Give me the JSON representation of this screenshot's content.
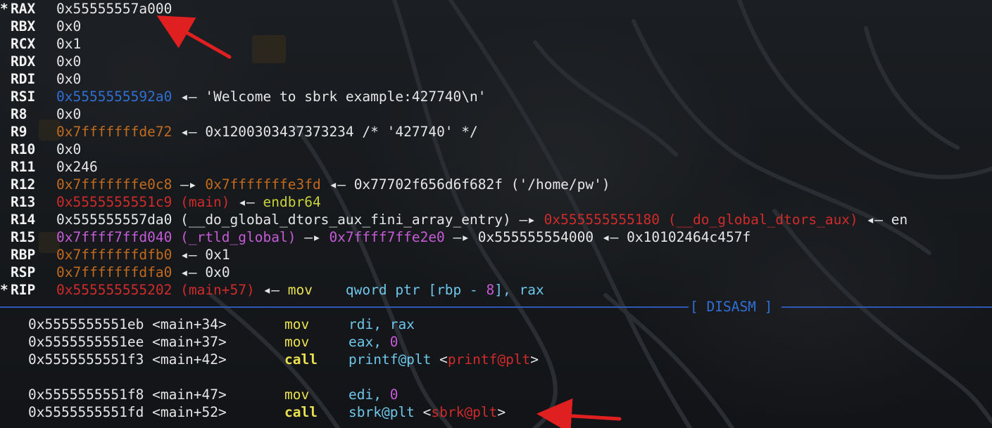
{
  "registers": [
    {
      "star": "*",
      "name": "RAX",
      "value": "0x55555557a000",
      "value_color": "w",
      "rest": []
    },
    {
      "star": "",
      "name": "RBX",
      "value": "0x0",
      "value_color": "w",
      "rest": []
    },
    {
      "star": "",
      "name": "RCX",
      "value": "0x1",
      "value_color": "w",
      "rest": []
    },
    {
      "star": "",
      "name": "RDX",
      "value": "0x0",
      "value_color": "w",
      "rest": []
    },
    {
      "star": "",
      "name": "RDI",
      "value": "0x0",
      "value_color": "w",
      "rest": []
    },
    {
      "star": "",
      "name": "RSI",
      "value": "0x5555555592a0",
      "value_color": "blue",
      "rest": [
        {
          "t": " ◂— ",
          "c": "w"
        },
        {
          "t": "'Welcome to sbrk example:427740\\n'",
          "c": "w"
        }
      ]
    },
    {
      "star": "",
      "name": "R8",
      "value": "0x0",
      "value_color": "w",
      "rest": []
    },
    {
      "star": "",
      "name": "R9",
      "value": "0x7fffffffde72",
      "value_color": "orange",
      "rest": [
        {
          "t": " ◂— ",
          "c": "w"
        },
        {
          "t": "0x1200303437373234 /* '427740' */",
          "c": "w"
        }
      ]
    },
    {
      "star": "",
      "name": "R10",
      "value": "0x0",
      "value_color": "w",
      "rest": []
    },
    {
      "star": "",
      "name": "R11",
      "value": "0x246",
      "value_color": "w",
      "rest": []
    },
    {
      "star": "",
      "name": "R12",
      "value": "0x7fffffffe0c8",
      "value_color": "orange",
      "rest": [
        {
          "t": " —▸ ",
          "c": "w"
        },
        {
          "t": "0x7fffffffe3fd",
          "c": "orange"
        },
        {
          "t": " ◂— ",
          "c": "w"
        },
        {
          "t": "0x77702f656d6f682f ('/home/pw')",
          "c": "w"
        }
      ]
    },
    {
      "star": "",
      "name": "R13",
      "value": "0x5555555551c9 (main)",
      "value_color": "red",
      "rest": [
        {
          "t": " ◂— ",
          "c": "w"
        },
        {
          "t": "endbr64",
          "c": "yellow"
        }
      ]
    },
    {
      "star": "",
      "name": "R14",
      "value": "0x555555557da0 (__do_global_dtors_aux_fini_array_entry)",
      "value_color": "w",
      "rest": [
        {
          "t": " —▸ ",
          "c": "w"
        },
        {
          "t": "0x555555555180 (__do_global_dtors_aux)",
          "c": "red"
        },
        {
          "t": " ◂— en",
          "c": "w"
        }
      ]
    },
    {
      "star": "",
      "name": "R15",
      "value": "0x7ffff7ffd040 (_rtld_global)",
      "value_color": "magenta",
      "rest": [
        {
          "t": " —▸ ",
          "c": "w"
        },
        {
          "t": "0x7ffff7ffe2e0",
          "c": "magenta"
        },
        {
          "t": " —▸ ",
          "c": "w"
        },
        {
          "t": "0x555555554000",
          "c": "w"
        },
        {
          "t": " ◂— ",
          "c": "w"
        },
        {
          "t": "0x10102464c457f",
          "c": "w"
        }
      ]
    },
    {
      "star": "",
      "name": "RBP",
      "value": "0x7fffffffdfb0",
      "value_color": "orange",
      "rest": [
        {
          "t": " ◂— ",
          "c": "w"
        },
        {
          "t": "0x1",
          "c": "w"
        }
      ]
    },
    {
      "star": "",
      "name": "RSP",
      "value": "0x7fffffffdfa0",
      "value_color": "orange",
      "rest": [
        {
          "t": " ◂— ",
          "c": "w"
        },
        {
          "t": "0x0",
          "c": "w"
        }
      ]
    },
    {
      "star": "*",
      "name": "RIP",
      "value": "0x555555555202 (main+57)",
      "value_color": "red",
      "rest": [
        {
          "t": " ◂— ",
          "c": "w"
        },
        {
          "t": "mov",
          "c": "kw"
        },
        {
          "t": "    qword ptr [rbp - ",
          "c": "cyan"
        },
        {
          "t": "8",
          "c": "magenta"
        },
        {
          "t": "], rax",
          "c": "cyan"
        }
      ]
    }
  ],
  "disasm_header": "[ DISASM ]",
  "disasm": [
    {
      "addr": "0x5555555551eb <main+34>",
      "op": "mov",
      "bold": false,
      "args": [
        {
          "t": "rdi, rax",
          "c": "cyan"
        }
      ]
    },
    {
      "addr": "0x5555555551ee <main+37>",
      "op": "mov",
      "bold": false,
      "args": [
        {
          "t": "eax, ",
          "c": "cyan"
        },
        {
          "t": "0",
          "c": "magenta"
        }
      ]
    },
    {
      "addr": "0x5555555551f3 <main+42>",
      "op": "call",
      "bold": true,
      "args": [
        {
          "t": "printf@plt ",
          "c": "cyan"
        },
        {
          "t": "<",
          "c": "w"
        },
        {
          "t": "printf@plt",
          "c": "red"
        },
        {
          "t": ">",
          "c": "w"
        }
      ]
    },
    {
      "addr": "",
      "op": "",
      "bold": false,
      "args": []
    },
    {
      "addr": "0x5555555551f8 <main+47>",
      "op": "mov",
      "bold": false,
      "args": [
        {
          "t": "edi, ",
          "c": "cyan"
        },
        {
          "t": "0",
          "c": "magenta"
        }
      ]
    },
    {
      "addr": "0x5555555551fd <main+52>",
      "op": "call",
      "bold": true,
      "args": [
        {
          "t": "sbrk@plt ",
          "c": "cyan"
        },
        {
          "t": "<",
          "c": "w"
        },
        {
          "t": "sbrk@plt",
          "c": "red"
        },
        {
          "t": ">",
          "c": "w"
        }
      ]
    }
  ],
  "annotation_color": "#e02020"
}
